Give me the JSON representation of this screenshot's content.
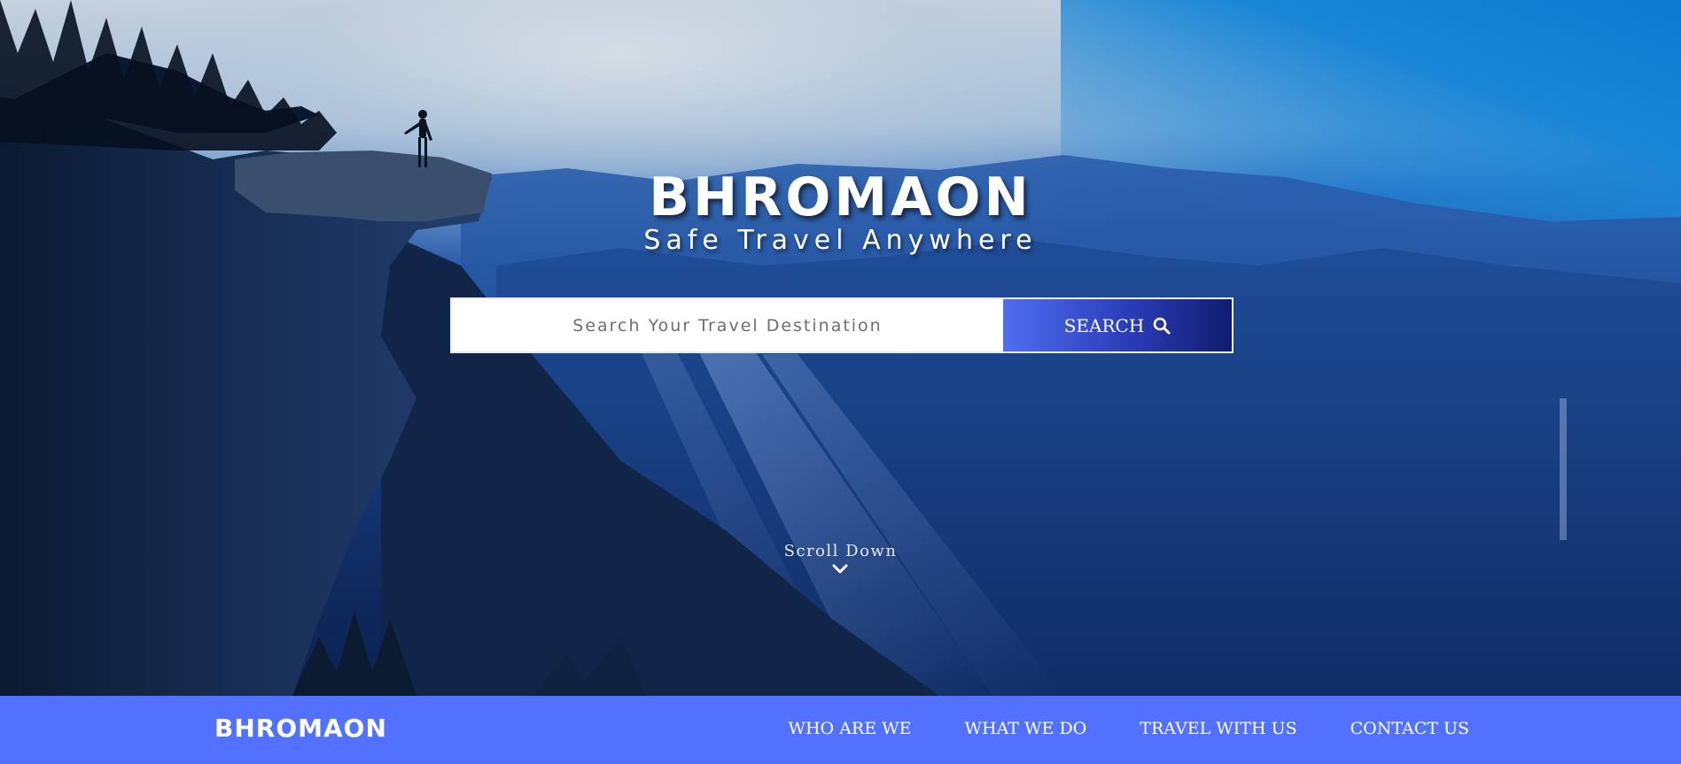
{
  "hero": {
    "title": "BHROMAON",
    "tagline": "Safe Travel Anywhere",
    "search": {
      "placeholder": "Search Your Travel Destination",
      "value": "",
      "button_label": "SEARCH",
      "button_icon": "search-icon"
    },
    "scroll_label": "Scroll Down",
    "scroll_icon": "chevron-down-icon"
  },
  "navbar": {
    "logo": "BHROMAON",
    "links": [
      {
        "label": "WHO ARE WE"
      },
      {
        "label": "WHAT WE DO"
      },
      {
        "label": "TRAVEL WITH US"
      },
      {
        "label": "CONTACT US"
      }
    ],
    "background": "#5271ff"
  },
  "colors": {
    "accent": "#5271ff",
    "button_gradient_start": "#4f6ef0",
    "button_gradient_end": "#0f1c6e"
  }
}
